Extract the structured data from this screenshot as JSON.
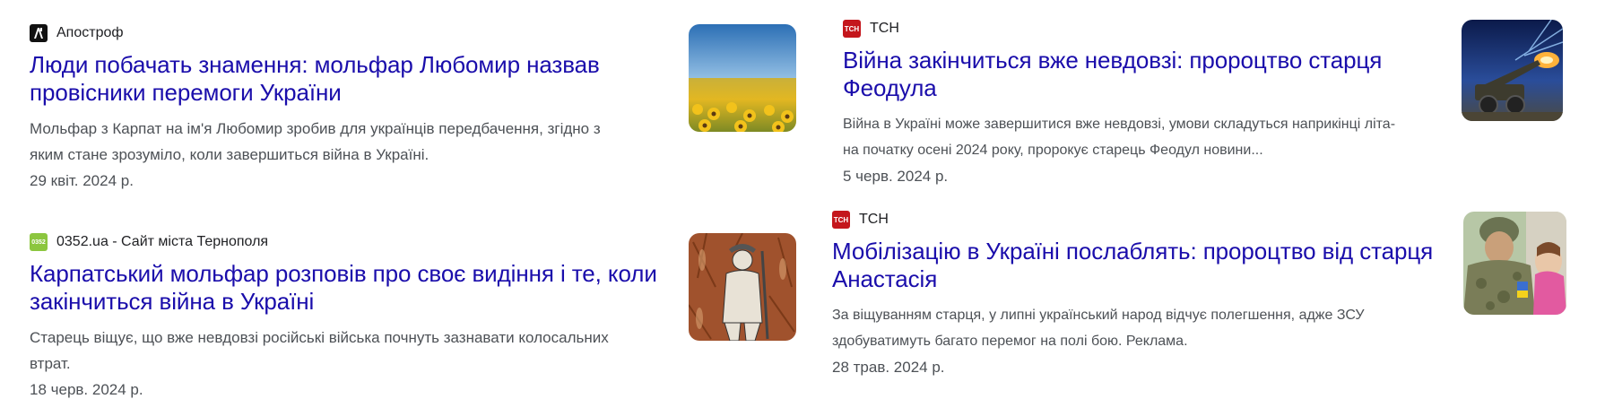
{
  "results": [
    {
      "source": "Апостроф",
      "title_line1": "Люди побачать знамення: мольфар Любомир назвав",
      "title_line2": "провісники перемоги України",
      "snippet_line1": "Мольфар з Карпат на ім'я Любомир зробив для українців передбачення, згідно з",
      "snippet_line2": "яким стане зрозуміло, коли завершиться війна в Україні.",
      "date": "29 квіт. 2024 р."
    },
    {
      "source": "0352.ua - Сайт міста Тернополя",
      "favicon_text": "0352",
      "title_line1": "Карпатський мольфар розповів про своє видіння і те, коли",
      "title_line2": "закінчиться війна в Україні",
      "snippet_line1": "Старець віщує, що вже невдовзі російські війська почнуть зазнавати колосальних",
      "snippet_line2": "втрат.",
      "date": "18 черв. 2024 р."
    },
    {
      "source": "ТСН",
      "favicon_text": "ТСН",
      "title_line1": "Війна закінчиться вже невдовзі: пророцтво старця",
      "title_line2": "Феодула",
      "snippet_line1": "Війна в Україні може завершитися вже невдовзі, умови складуться наприкінці літа-",
      "snippet_line2": "на початку осені 2024 року, пророкує старець Феодул новини...",
      "date": "5 черв. 2024 р."
    },
    {
      "source": "ТСН",
      "favicon_text": "ТСН",
      "title_line1": "Мобілізацію в Україні послаблять: пророцтво від старця",
      "title_line2": "Анастасія",
      "snippet_line1": "За віщуванням старця, у липні український народ відчує полегшення, адже ЗСУ",
      "snippet_line2": "здобуватимуть багато перемог на полі бою. Реклама.",
      "date": "28 трав. 2024 р."
    }
  ],
  "colors": {
    "link": "#1a0dab",
    "snippet": "#4d5156",
    "tsn_favicon": "#c4161c",
    "site0352_favicon": "#8cc63f"
  }
}
